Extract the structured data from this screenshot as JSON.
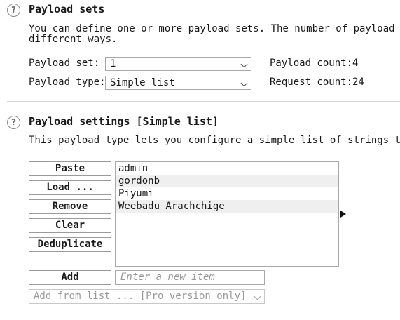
{
  "payload_sets": {
    "title": "Payload sets",
    "description_line1": "You can define one or more payload sets. The number of payload sets",
    "description_line2": "different ways.",
    "set_label": "Payload set:",
    "set_value": "1",
    "type_label": "Payload type:",
    "type_value": "Simple list",
    "payload_count_label": "Payload count:",
    "payload_count_value": "4",
    "request_count_label": "Request count:",
    "request_count_value": "24",
    "help_glyph": "?"
  },
  "payload_settings": {
    "title": "Payload settings [Simple list]",
    "description": "This payload type lets you configure a simple list of strings that",
    "help_glyph": "?",
    "buttons": {
      "paste": "Paste",
      "load": "Load ...",
      "remove": "Remove",
      "clear": "Clear",
      "deduplicate": "Deduplicate",
      "add": "Add"
    },
    "items": [
      "admin",
      "gordonb",
      "Piyumi",
      "Weebadu Arachchige"
    ],
    "new_item_placeholder": "Enter a new item",
    "add_from_list": "Add from list ... [Pro version only]"
  },
  "icons": {
    "help": "help-icon",
    "dropdown": "chevron-down-icon",
    "pointer": "arrow-right-icon"
  }
}
